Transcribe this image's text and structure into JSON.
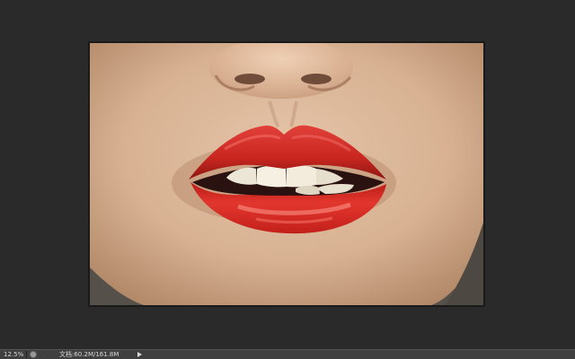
{
  "statusbar": {
    "zoom": "12.5%",
    "doc_info": "文档:60.2M/161.8M",
    "info_icon": "document-info-icon",
    "menu_icon": "play-arrow-icon"
  },
  "document": {
    "image_subject": "close-up of lips with red lipstick",
    "lip_color": "#d22a23",
    "skin_color": "#d9b79a"
  },
  "colors": {
    "workspace": "#2a2a2a",
    "statusbar": "#3f3f3f"
  }
}
